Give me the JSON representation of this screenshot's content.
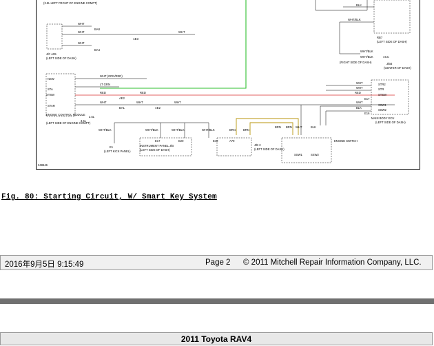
{
  "diagram": {
    "id": "348646",
    "labels": {
      "top_left_note": "(3.5L LEFT FRONT OF ENGINE COMPT)",
      "jc_block": "J/C A95",
      "jc_sub": "(LEFT SIDE OF DASH)",
      "ecm": "ENGINE CONTROL MODULE",
      "ecm_sub": "(LEFT SIDE OF ENGINE COMPT)",
      "ecm_35l": "3.5L",
      "ecm_25l": "2.5L",
      "e1": "E1",
      "e1_sub": "(LEFT KICK PANEL)",
      "instrument": "INSTRUMENT PANEL J/B",
      "instrument_sub": "(LEFT SIDE OF DASH)",
      "jb2": "J/B 2",
      "jb2_sub": "(LEFT SIDE OF DASH)",
      "engine_switch": "ENGINE SWITCH",
      "mainbody": "MAIN BODY ECU",
      "mainbody_sub": "(LEFT SIDE OF DASH)",
      "rb7": "RB7",
      "rb7_sub": "(LEFT SIDE OF DASH)",
      "e31": "E31",
      "e31_sub": "(RIGHT SIDE OF DASH)",
      "jb4": "J/B4",
      "jb4_sub": "(CENTER OF DASH)"
    },
    "wires": {
      "wht": "WHT",
      "blk": "BLK",
      "wht_blk": "WHT/BLK",
      "red": "RED",
      "brn": "BRN",
      "ltgrn": "LT GRN",
      "wht_grn_red": "WHT (GRN/RED)"
    },
    "pins": {
      "nsw": "NSW",
      "sta": "STA",
      "stsw": "STSW",
      "star": "STAR",
      "str2": "STR2",
      "str": "STR",
      "stsw_r": "STSW",
      "ssw1": "SSW1",
      "ssw2": "SSW2",
      "acc": "ACC",
      "e8": "E8",
      "e16": "E16",
      "e17": "E17",
      "e20": "E20",
      "e40": "E40",
      "a79": "A79",
      "ba8": "BA8",
      "ba4": "BA4",
      "ae2": "AE2",
      "ae3": "AE3",
      "a62": "A62",
      "ba1": "BA1"
    }
  },
  "figure": {
    "caption": "Fig. 80: Starting Circuit, W/ Smart Key System"
  },
  "footer": {
    "datetime": "2016年9月5日  9:15:49",
    "page": "Page 2",
    "copyright": "© 2011 Mitchell Repair Information Company, LLC."
  },
  "next_page": {
    "title": "2011 Toyota RAV4"
  }
}
